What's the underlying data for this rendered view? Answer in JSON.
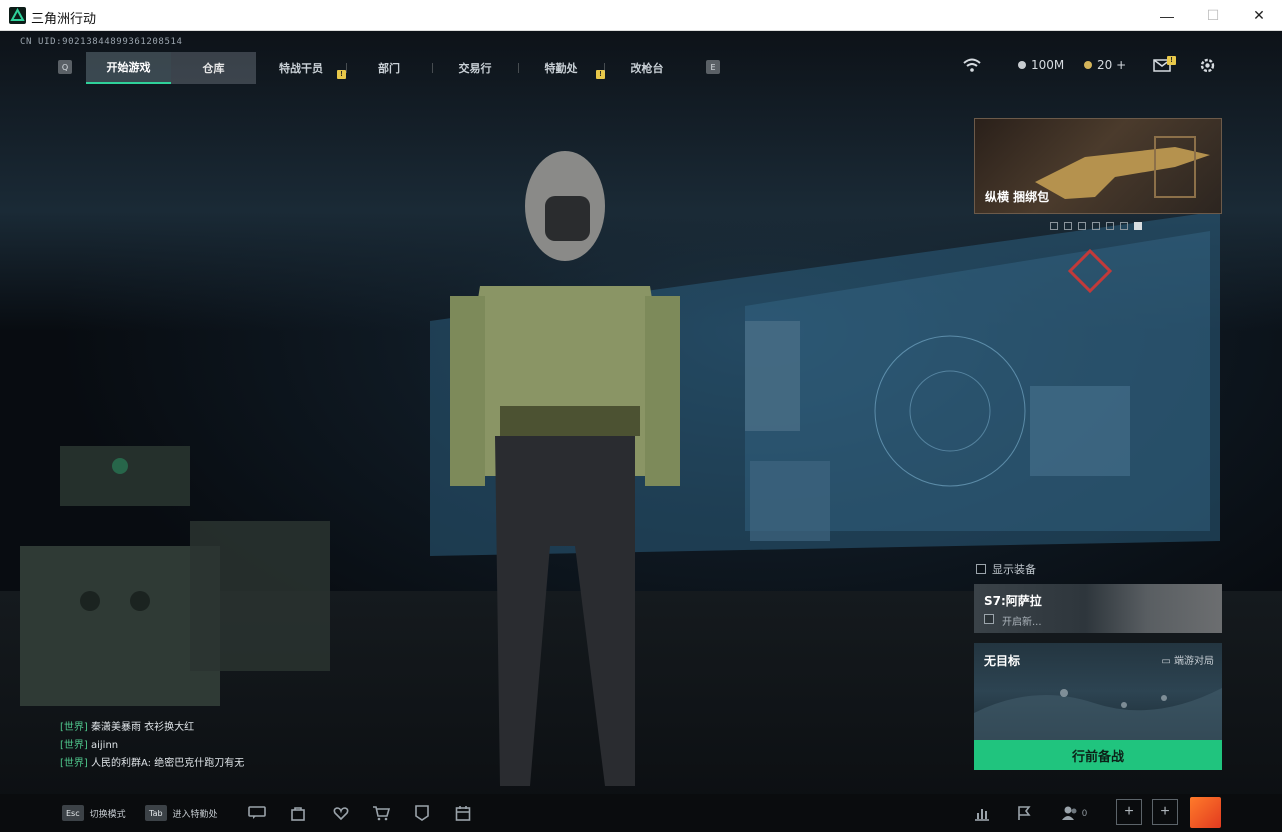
{
  "window": {
    "title": "三角洲行动",
    "controls": {
      "minimize": "—",
      "maximize": "☐",
      "close": "✕"
    }
  },
  "uid_text": "CN UID:90213844899361208514",
  "nav": {
    "left_key": "Q",
    "right_key": "E",
    "tabs": [
      {
        "label": "开始游戏"
      },
      {
        "label": "仓库"
      },
      {
        "label": "特战干员"
      },
      {
        "label": "部门"
      },
      {
        "label": "交易行"
      },
      {
        "label": "特勤处"
      },
      {
        "label": "改枪台"
      }
    ],
    "badge_text": "!"
  },
  "currency": {
    "silver": "100M",
    "gold": "20 +"
  },
  "promo": {
    "label": "纵横 捆绑包"
  },
  "show_equipment_label": "显示装备",
  "season": {
    "title": "S7:阿萨拉",
    "subtitle": "开启新..."
  },
  "mode": {
    "title": "无目标",
    "tag": "端游对局"
  },
  "start_button": "行前备战",
  "chat": [
    {
      "channel": "[世界]",
      "text": "秦潇美暴雨 衣衫换大红"
    },
    {
      "channel": "[世界]",
      "text": "aijinn"
    },
    {
      "channel": "[世界]",
      "text": "人民的利群A: 绝密巴克什跑刀有无"
    }
  ],
  "bottom": {
    "esc_key": "Esc",
    "esc_label": "切换模式",
    "tab_key": "Tab",
    "tab_label": "进入特勤处",
    "friends_count": "0"
  },
  "colors": {
    "accent_green": "#20c47e",
    "badge_yellow": "#e8c84a"
  },
  "icons": [
    "chat-icon",
    "shop-bag-icon",
    "heart-shield-icon",
    "cart-icon",
    "rank-icon",
    "calendar-icon",
    "wifi-icon",
    "mail-icon",
    "settings-icon",
    "stats-icon",
    "flag-icon",
    "friends-icon"
  ]
}
